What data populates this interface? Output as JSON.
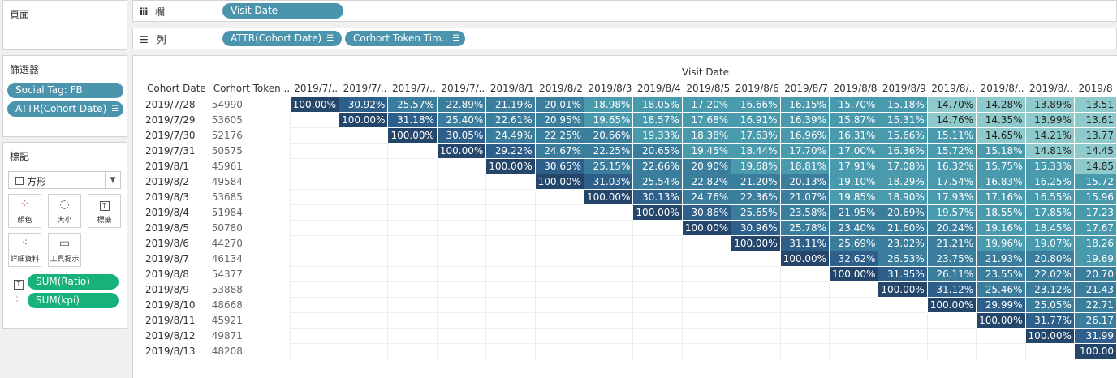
{
  "panels": {
    "pages_title": "頁面",
    "filters_title": "篩選器",
    "marks_title": "標記",
    "filters": [
      "Social Tag: FB",
      "ATTR(Cohort Date)"
    ],
    "mark_type": "方形",
    "mark_buttons": [
      "顏色",
      "大小",
      "標籤",
      "詳細資料",
      "工具提示"
    ],
    "mark_pills": [
      "SUM(Ratio)",
      "SUM(kpi)"
    ]
  },
  "shelves": {
    "columns_label": "欄",
    "rows_label": "列",
    "columns_pills": [
      "Visit Date"
    ],
    "rows_pills": [
      "ATTR(Cohort Date)",
      "Corhort Token Tim.."
    ]
  },
  "table": {
    "axis_title": "Visit Date",
    "row_headers": [
      "Cohort Date",
      "Corhort Token .."
    ],
    "columns": [
      "2019/7/..",
      "2019/7/..",
      "2019/7/..",
      "2019/7/..",
      "2019/8/1",
      "2019/8/2",
      "2019/8/3",
      "2019/8/4",
      "2019/8/5",
      "2019/8/6",
      "2019/8/7",
      "2019/8/8",
      "2019/8/9",
      "2019/8/..",
      "2019/8/..",
      "2019/8/..",
      "2019/8"
    ],
    "rows": [
      {
        "date": "2019/7/28",
        "token": "54990",
        "values": [
          "100.00%",
          "30.92%",
          "25.57%",
          "22.89%",
          "21.19%",
          "20.01%",
          "18.98%",
          "18.05%",
          "17.20%",
          "16.66%",
          "16.15%",
          "15.70%",
          "15.18%",
          "14.70%",
          "14.28%",
          "13.89%",
          "13.51"
        ]
      },
      {
        "date": "2019/7/29",
        "token": "53605",
        "values": [
          "",
          "100.00%",
          "31.18%",
          "25.40%",
          "22.61%",
          "20.95%",
          "19.65%",
          "18.57%",
          "17.68%",
          "16.91%",
          "16.39%",
          "15.87%",
          "15.31%",
          "14.76%",
          "14.35%",
          "13.99%",
          "13.61"
        ]
      },
      {
        "date": "2019/7/30",
        "token": "52176",
        "values": [
          "",
          "",
          "100.00%",
          "30.05%",
          "24.49%",
          "22.25%",
          "20.66%",
          "19.33%",
          "18.38%",
          "17.63%",
          "16.96%",
          "16.31%",
          "15.66%",
          "15.11%",
          "14.65%",
          "14.21%",
          "13.77"
        ]
      },
      {
        "date": "2019/7/31",
        "token": "50575",
        "values": [
          "",
          "",
          "",
          "100.00%",
          "29.22%",
          "24.67%",
          "22.25%",
          "20.65%",
          "19.45%",
          "18.44%",
          "17.70%",
          "17.00%",
          "16.36%",
          "15.72%",
          "15.18%",
          "14.81%",
          "14.45"
        ]
      },
      {
        "date": "2019/8/1",
        "token": "45961",
        "values": [
          "",
          "",
          "",
          "",
          "100.00%",
          "30.65%",
          "25.15%",
          "22.66%",
          "20.90%",
          "19.68%",
          "18.81%",
          "17.91%",
          "17.08%",
          "16.32%",
          "15.75%",
          "15.33%",
          "14.85"
        ]
      },
      {
        "date": "2019/8/2",
        "token": "49584",
        "values": [
          "",
          "",
          "",
          "",
          "",
          "100.00%",
          "31.03%",
          "25.54%",
          "22.82%",
          "21.20%",
          "20.13%",
          "19.10%",
          "18.29%",
          "17.54%",
          "16.83%",
          "16.25%",
          "15.72"
        ]
      },
      {
        "date": "2019/8/3",
        "token": "53685",
        "values": [
          "",
          "",
          "",
          "",
          "",
          "",
          "100.00%",
          "30.13%",
          "24.76%",
          "22.36%",
          "21.07%",
          "19.85%",
          "18.90%",
          "17.93%",
          "17.16%",
          "16.55%",
          "15.96"
        ]
      },
      {
        "date": "2019/8/4",
        "token": "51984",
        "values": [
          "",
          "",
          "",
          "",
          "",
          "",
          "",
          "100.00%",
          "30.86%",
          "25.65%",
          "23.58%",
          "21.95%",
          "20.69%",
          "19.57%",
          "18.55%",
          "17.85%",
          "17.23"
        ]
      },
      {
        "date": "2019/8/5",
        "token": "50780",
        "values": [
          "",
          "",
          "",
          "",
          "",
          "",
          "",
          "",
          "100.00%",
          "30.96%",
          "25.78%",
          "23.40%",
          "21.60%",
          "20.24%",
          "19.16%",
          "18.45%",
          "17.67"
        ]
      },
      {
        "date": "2019/8/6",
        "token": "44270",
        "values": [
          "",
          "",
          "",
          "",
          "",
          "",
          "",
          "",
          "",
          "100.00%",
          "31.11%",
          "25.69%",
          "23.02%",
          "21.21%",
          "19.96%",
          "19.07%",
          "18.26"
        ]
      },
      {
        "date": "2019/8/7",
        "token": "46134",
        "values": [
          "",
          "",
          "",
          "",
          "",
          "",
          "",
          "",
          "",
          "",
          "100.00%",
          "32.62%",
          "26.53%",
          "23.75%",
          "21.93%",
          "20.80%",
          "19.69"
        ]
      },
      {
        "date": "2019/8/8",
        "token": "54377",
        "values": [
          "",
          "",
          "",
          "",
          "",
          "",
          "",
          "",
          "",
          "",
          "",
          "100.00%",
          "31.95%",
          "26.11%",
          "23.55%",
          "22.02%",
          "20.70"
        ]
      },
      {
        "date": "2019/8/9",
        "token": "53888",
        "values": [
          "",
          "",
          "",
          "",
          "",
          "",
          "",
          "",
          "",
          "",
          "",
          "",
          "100.00%",
          "31.12%",
          "25.46%",
          "23.12%",
          "21.43"
        ]
      },
      {
        "date": "2019/8/10",
        "token": "48668",
        "values": [
          "",
          "",
          "",
          "",
          "",
          "",
          "",
          "",
          "",
          "",
          "",
          "",
          "",
          "100.00%",
          "29.99%",
          "25.05%",
          "22.71"
        ]
      },
      {
        "date": "2019/8/11",
        "token": "45921",
        "values": [
          "",
          "",
          "",
          "",
          "",
          "",
          "",
          "",
          "",
          "",
          "",
          "",
          "",
          "",
          "100.00%",
          "31.77%",
          "26.17"
        ]
      },
      {
        "date": "2019/8/12",
        "token": "49871",
        "values": [
          "",
          "",
          "",
          "",
          "",
          "",
          "",
          "",
          "",
          "",
          "",
          "",
          "",
          "",
          "",
          "100.00%",
          "31.99"
        ]
      },
      {
        "date": "2019/8/13",
        "token": "48208",
        "values": [
          "",
          "",
          "",
          "",
          "",
          "",
          "",
          "",
          "",
          "",
          "",
          "",
          "",
          "",
          "",
          "",
          "100.00"
        ]
      }
    ]
  }
}
